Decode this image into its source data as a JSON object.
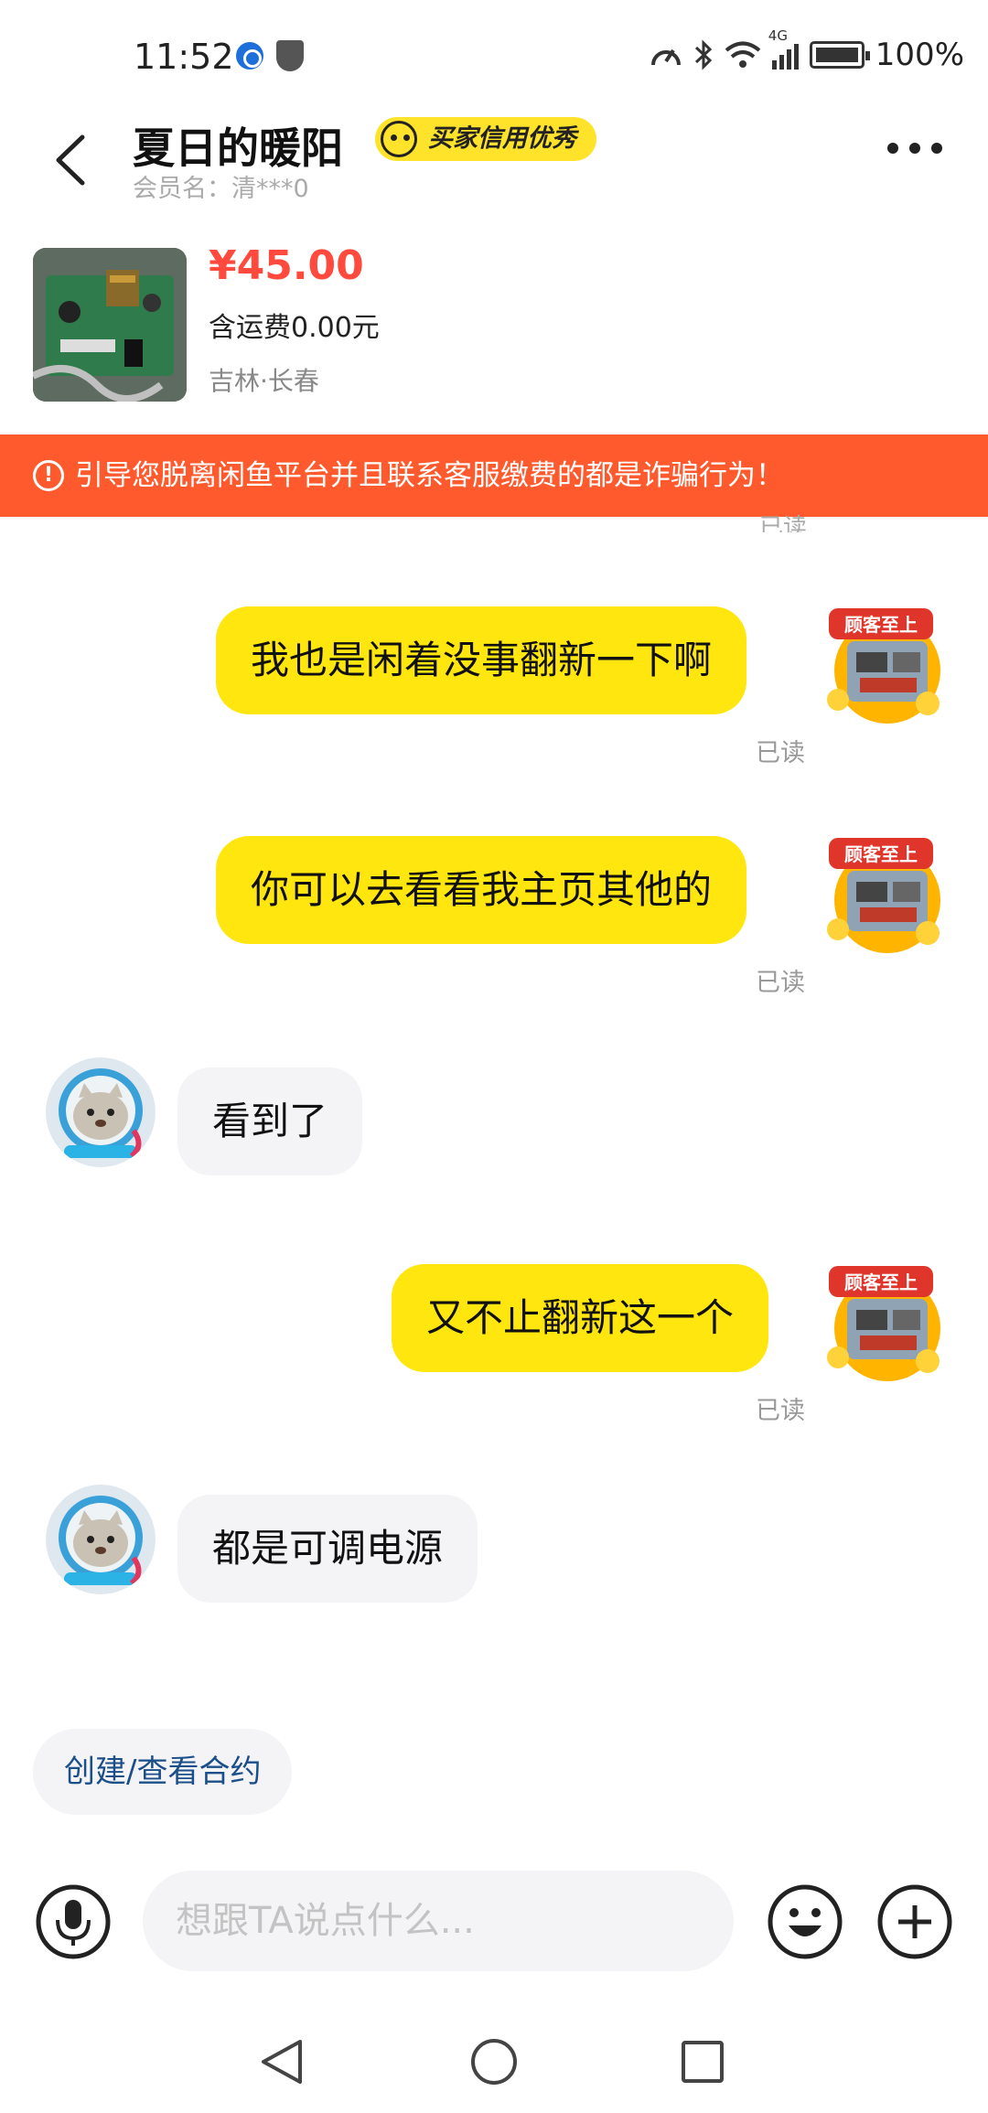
{
  "status_bar": {
    "time": "11:52",
    "network": "4G",
    "battery": "100%"
  },
  "header": {
    "title": "夏日的暖阳",
    "badge": "买家信用优秀",
    "member_name": "会员名：清***0",
    "back_icon": "chevron-left-icon",
    "more_icon": "more-dots-icon"
  },
  "product": {
    "price": "¥45.00",
    "shipping": "含运费0.00元",
    "location": "吉林·长春"
  },
  "warning": {
    "text": "引导您脱离闲鱼平台并且联系客服缴费的都是诈骗行为！",
    "icon": "alert-circle-icon",
    "color": "#ff5a2e"
  },
  "read_label": "已读",
  "messages": [
    {
      "sender": "me",
      "text": "我也是闲着没事翻新一下啊",
      "status": "已读"
    },
    {
      "sender": "me",
      "text": "你可以去看看我主页其他的",
      "status": "已读"
    },
    {
      "sender": "them",
      "text": "看到了"
    },
    {
      "sender": "me",
      "text": "又不止翻新这一个",
      "status": "已读"
    },
    {
      "sender": "them",
      "text": "都是可调电源"
    }
  ],
  "avatar_mine": {
    "badge_text": "顾客至上"
  },
  "contract_button": "创建/查看合约",
  "composer": {
    "placeholder": "想跟TA说点什么...",
    "mic_icon": "microphone-icon",
    "emoji_icon": "emoji-icon",
    "plus_icon": "plus-icon"
  },
  "colors": {
    "my_bubble": "#ffe60f",
    "their_bubble": "#f4f3f5",
    "price": "#ff4a3d",
    "contract_text": "#1b4f89"
  }
}
